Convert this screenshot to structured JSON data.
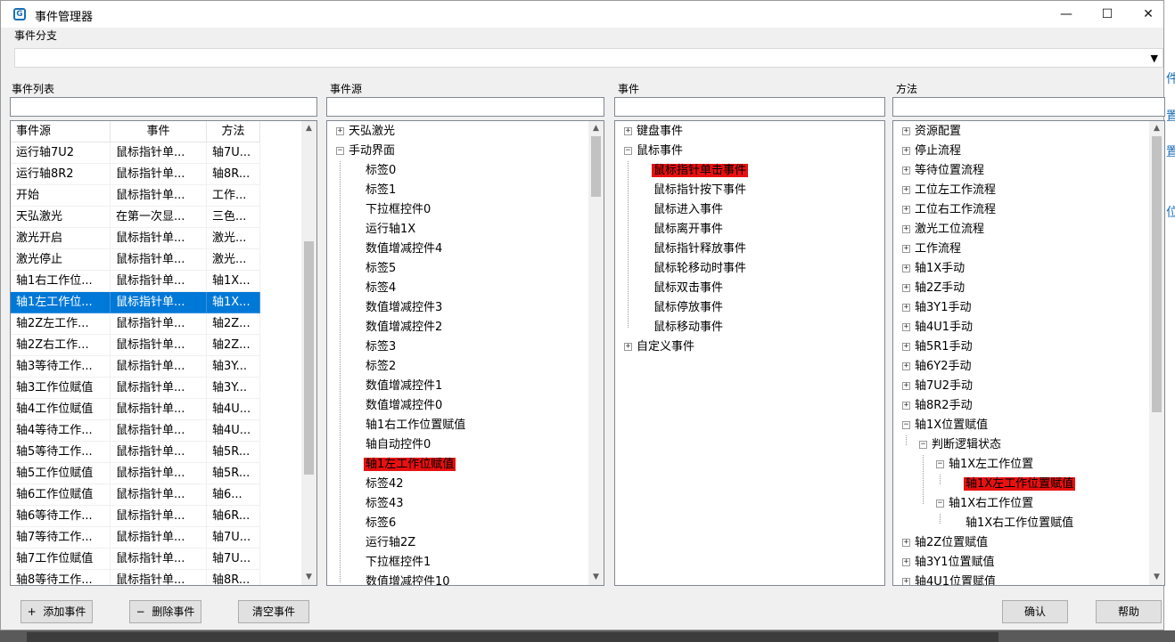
{
  "window": {
    "title": "事件管理器",
    "icon": "app-logo-icon"
  },
  "branch": {
    "label": "事件分支",
    "value": ""
  },
  "event_list": {
    "label": "事件列表",
    "columns": [
      "事件源",
      "事件",
      "方法"
    ],
    "rows": [
      [
        "运行轴7U2",
        "鼠标指针单...",
        "轴7U..."
      ],
      [
        "运行轴8R2",
        "鼠标指针单...",
        "轴8R..."
      ],
      [
        "开始",
        "鼠标指针单...",
        "工作..."
      ],
      [
        "天弘激光",
        "在第一次显...",
        "三色..."
      ],
      [
        "激光开启",
        "鼠标指针单...",
        "激光..."
      ],
      [
        "激光停止",
        "鼠标指针单...",
        "激光..."
      ],
      [
        "轴1右工作位...",
        "鼠标指针单...",
        "轴1X..."
      ],
      [
        "轴1左工作位...",
        "鼠标指针单...",
        "轴1X..."
      ],
      [
        "轴2Z左工作...",
        "鼠标指针单...",
        "轴2Z..."
      ],
      [
        "轴2Z右工作...",
        "鼠标指针单...",
        "轴2Z..."
      ],
      [
        "轴3等待工作...",
        "鼠标指针单...",
        "轴3Y..."
      ],
      [
        "轴3工作位赋值",
        "鼠标指针单...",
        "轴3Y..."
      ],
      [
        "轴4工作位赋值",
        "鼠标指针单...",
        "轴4U..."
      ],
      [
        "轴4等待工作...",
        "鼠标指针单...",
        "轴4U..."
      ],
      [
        "轴5等待工作...",
        "鼠标指针单...",
        "轴5R..."
      ],
      [
        "轴5工作位赋值",
        "鼠标指针单...",
        "轴5R..."
      ],
      [
        "轴6工作位赋值",
        "鼠标指针单...",
        "轴6..."
      ],
      [
        "轴6等待工作...",
        "鼠标指针单...",
        "轴6R..."
      ],
      [
        "轴7等待工作...",
        "鼠标指针单...",
        "轴7U..."
      ],
      [
        "轴7工作位赋值",
        "鼠标指针单...",
        "轴7U..."
      ],
      [
        "轴8等待工作...",
        "鼠标指针单...",
        "轴8R..."
      ]
    ],
    "selected_index": 7
  },
  "source": {
    "label": "事件源",
    "filter": "",
    "nodes": [
      {
        "text": "天弘激光",
        "level": 0,
        "exp": "+"
      },
      {
        "text": "手动界面",
        "level": 0,
        "exp": "-"
      },
      {
        "text": "标签0",
        "level": 1
      },
      {
        "text": "标签1",
        "level": 1
      },
      {
        "text": "下拉框控件0",
        "level": 1
      },
      {
        "text": "运行轴1X",
        "level": 1
      },
      {
        "text": "数值增减控件4",
        "level": 1
      },
      {
        "text": "标签5",
        "level": 1
      },
      {
        "text": "标签4",
        "level": 1
      },
      {
        "text": "数值增减控件3",
        "level": 1
      },
      {
        "text": "数值增减控件2",
        "level": 1
      },
      {
        "text": "标签3",
        "level": 1
      },
      {
        "text": "标签2",
        "level": 1
      },
      {
        "text": "数值增减控件1",
        "level": 1
      },
      {
        "text": "数值增减控件0",
        "level": 1
      },
      {
        "text": "轴1右工作位置赋值",
        "level": 1
      },
      {
        "text": "轴自动控件0",
        "level": 1
      },
      {
        "text": "轴1左工作位赋值",
        "level": 1,
        "hl": true
      },
      {
        "text": "标签42",
        "level": 1
      },
      {
        "text": "标签43",
        "level": 1
      },
      {
        "text": "标签6",
        "level": 1
      },
      {
        "text": "运行轴2Z",
        "level": 1
      },
      {
        "text": "下拉框控件1",
        "level": 1
      },
      {
        "text": "数值增减控件10",
        "level": 1
      }
    ]
  },
  "events": {
    "label": "事件",
    "filter": "",
    "nodes": [
      {
        "text": "键盘事件",
        "level": 0,
        "exp": "+"
      },
      {
        "text": "鼠标事件",
        "level": 0,
        "exp": "-"
      },
      {
        "text": "鼠标指针单击事件",
        "level": 1,
        "hl": true
      },
      {
        "text": "鼠标指针按下事件",
        "level": 1
      },
      {
        "text": "鼠标进入事件",
        "level": 1
      },
      {
        "text": "鼠标离开事件",
        "level": 1
      },
      {
        "text": "鼠标指针释放事件",
        "level": 1
      },
      {
        "text": "鼠标轮移动时事件",
        "level": 1
      },
      {
        "text": "鼠标双击事件",
        "level": 1
      },
      {
        "text": "鼠标停放事件",
        "level": 1
      },
      {
        "text": "鼠标移动事件",
        "level": 1
      },
      {
        "text": "自定义事件",
        "level": 0,
        "exp": "+"
      }
    ]
  },
  "methods": {
    "label": "方法",
    "filter": "",
    "nodes": [
      {
        "text": "资源配置",
        "level": 0,
        "exp": "+"
      },
      {
        "text": "停止流程",
        "level": 0,
        "exp": "+"
      },
      {
        "text": "等待位置流程",
        "level": 0,
        "exp": "+"
      },
      {
        "text": "工位左工作流程",
        "level": 0,
        "exp": "+"
      },
      {
        "text": "工位右工作流程",
        "level": 0,
        "exp": "+"
      },
      {
        "text": "激光工位流程",
        "level": 0,
        "exp": "+"
      },
      {
        "text": "工作流程",
        "level": 0,
        "exp": "+"
      },
      {
        "text": "轴1X手动",
        "level": 0,
        "exp": "+"
      },
      {
        "text": "轴2Z手动",
        "level": 0,
        "exp": "+"
      },
      {
        "text": "轴3Y1手动",
        "level": 0,
        "exp": "+"
      },
      {
        "text": "轴4U1手动",
        "level": 0,
        "exp": "+"
      },
      {
        "text": "轴5R1手动",
        "level": 0,
        "exp": "+"
      },
      {
        "text": "轴6Y2手动",
        "level": 0,
        "exp": "+"
      },
      {
        "text": "轴7U2手动",
        "level": 0,
        "exp": "+"
      },
      {
        "text": "轴8R2手动",
        "level": 0,
        "exp": "+"
      },
      {
        "text": "轴1X位置赋值",
        "level": 0,
        "exp": "-"
      },
      {
        "text": "判断逻辑状态",
        "level": 1,
        "exp": "-"
      },
      {
        "text": "轴1X左工作位置",
        "level": 2,
        "exp": "-"
      },
      {
        "text": "轴1X左工作位置赋值",
        "level": 3,
        "hl": true
      },
      {
        "text": "轴1X右工作位置",
        "level": 2,
        "exp": "-"
      },
      {
        "text": "轴1X右工作位置赋值",
        "level": 3
      },
      {
        "text": "轴2Z位置赋值",
        "level": 0,
        "exp": "+"
      },
      {
        "text": "轴3Y1位置赋值",
        "level": 0,
        "exp": "+"
      },
      {
        "text": "轴4U1位置赋值",
        "level": 0,
        "exp": "+"
      }
    ]
  },
  "buttons": {
    "add": "添加事件",
    "delete": "删除事件",
    "clear": "清空事件",
    "confirm": "确认",
    "help": "帮助"
  },
  "colors": {
    "selection": "#0078d7",
    "highlight": "#e81010"
  }
}
